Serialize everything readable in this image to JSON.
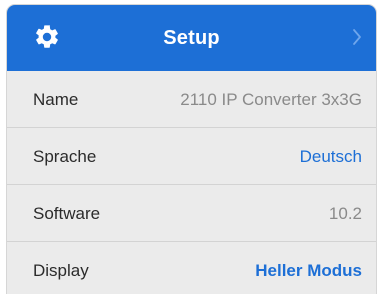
{
  "header": {
    "title": "Setup",
    "left_icon": "gear-icon",
    "right_icon": "chevron-right-icon",
    "background_color": "#1d6fd6"
  },
  "rows": [
    {
      "label": "Name",
      "value": "2110 IP Converter 3x3G",
      "value_color": "#8a8a8a"
    },
    {
      "label": "Sprache",
      "value": "Deutsch",
      "value_color": "#1d6fd6"
    },
    {
      "label": "Software",
      "value": "10.2",
      "value_color": "#8a8a8a"
    },
    {
      "label": "Display",
      "value": "Heller Modus",
      "value_color": "#1d6fd6"
    }
  ]
}
